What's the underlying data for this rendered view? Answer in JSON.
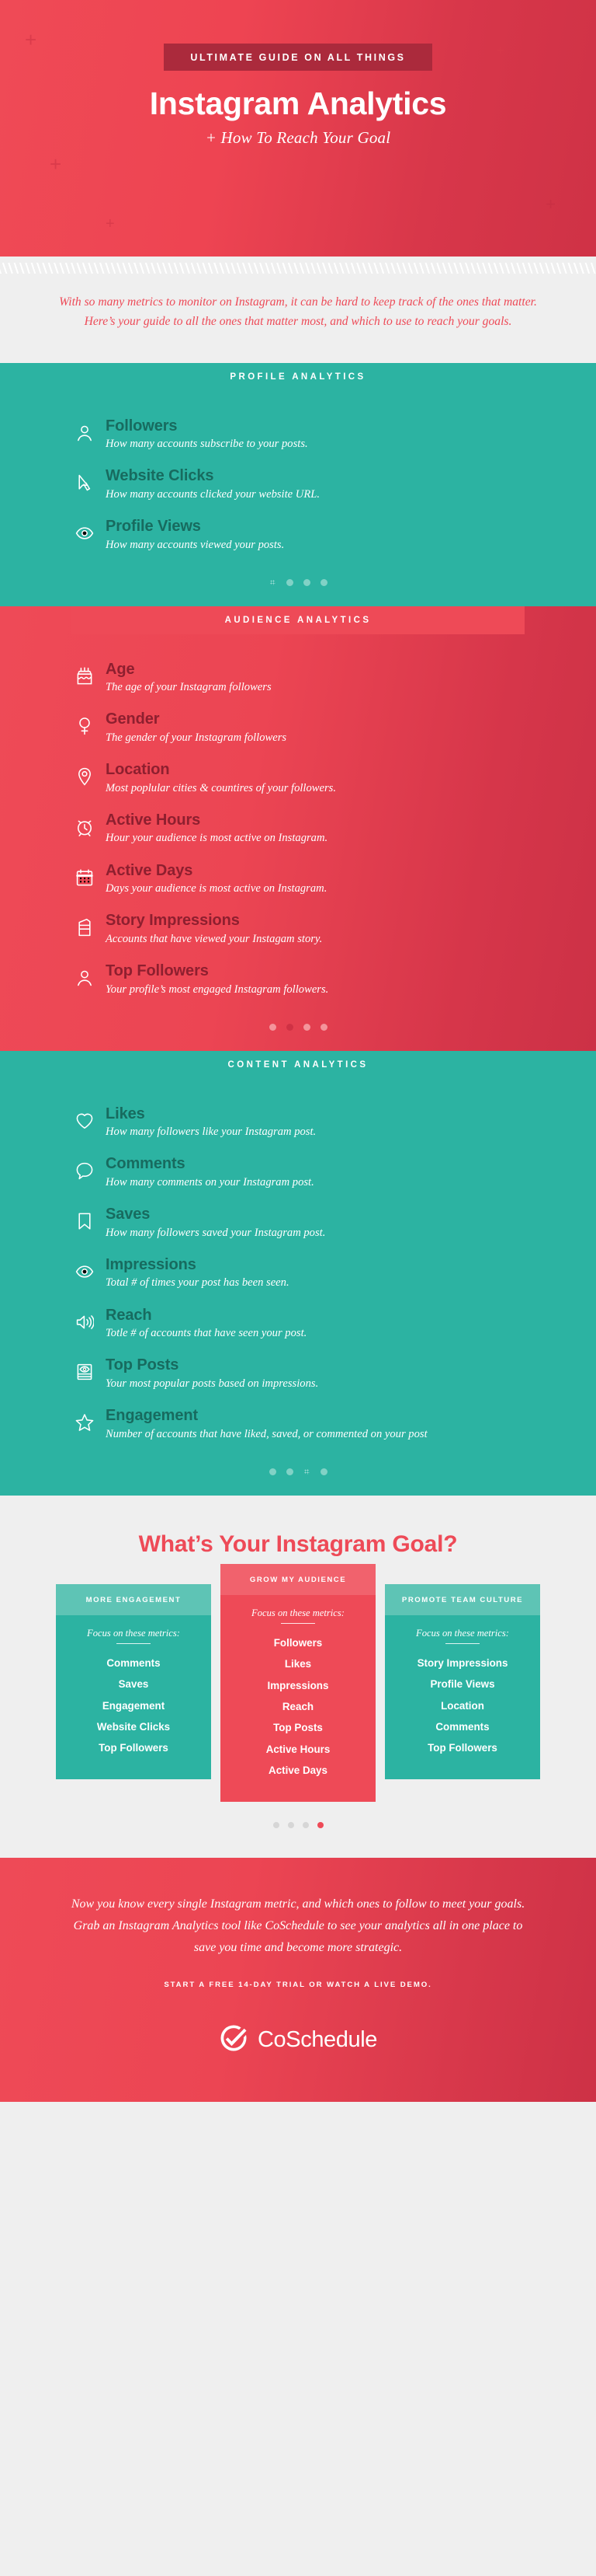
{
  "hero": {
    "eyebrow": "Ultimate Guide on All Things",
    "title": "Instagram Analytics",
    "subtitle": "+ How To Reach Your Goal"
  },
  "intro": {
    "paragraph": "With so many metrics to monitor on Instagram, it can be hard to keep track of the ones that matter. Here’s your guide to all the ones that matter most, and which to use to reach your goals."
  },
  "colors": {
    "red": "#ee4a57",
    "red_dark": "#ab2a3c",
    "teal": "#2cb3a2",
    "teal_dark": "#176b5f",
    "maroon_text": "#8e1f2f",
    "page_bg": "#efefef"
  },
  "sections": [
    {
      "id": "profile-analytics",
      "header": "Profile Analytics",
      "theme": "teal",
      "items": [
        {
          "icon": "person-icon",
          "title": "Followers",
          "desc": "How many accounts subscribe to your posts."
        },
        {
          "icon": "cursor-icon",
          "title": "Website Clicks",
          "desc": "How many accounts clicked your website URL."
        },
        {
          "icon": "eye-icon",
          "title": "Profile Views",
          "desc": "How many accounts viewed your posts."
        }
      ],
      "dots": {
        "count": 4,
        "states": [
          "ghost",
          "on",
          "on",
          "on"
        ]
      }
    },
    {
      "id": "audience-analytics",
      "header": "Audience Analytics",
      "theme": "red",
      "items": [
        {
          "icon": "cake-icon",
          "title": "Age",
          "desc": "The age of your Instagram followers"
        },
        {
          "icon": "gender-icon",
          "title": "Gender",
          "desc": "The gender of your Instagram followers"
        },
        {
          "icon": "map-pin-icon",
          "title": "Location",
          "desc": "Most poplular cities & countires of your followers."
        },
        {
          "icon": "alarm-clock-icon",
          "title": "Active Hours",
          "desc": "Hour your audience is most active on Instagram."
        },
        {
          "icon": "calendar-icon",
          "title": "Active Days",
          "desc": "Days your audience is most active on Instagram."
        },
        {
          "icon": "story-icon",
          "title": "Story Impressions",
          "desc": "Accounts that have viewed your Instagam story."
        },
        {
          "icon": "person-icon",
          "title": "Top Followers",
          "desc": "Your profile’s most engaged Instagram followers."
        }
      ],
      "dots": {
        "count": 4,
        "states": [
          "on",
          "active",
          "on",
          "on"
        ]
      }
    },
    {
      "id": "content-analytics",
      "header": "Content Analytics",
      "theme": "teal",
      "items": [
        {
          "icon": "heart-icon",
          "title": "Likes",
          "desc": "How many followers like your Instagram post."
        },
        {
          "icon": "comment-icon",
          "title": "Comments",
          "desc": "How many comments on your Instagram post."
        },
        {
          "icon": "bookmark-icon",
          "title": "Saves",
          "desc": "How many followers saved your Instagram post."
        },
        {
          "icon": "eye-icon",
          "title": "Impressions",
          "desc": "Total # of times your post has been seen."
        },
        {
          "icon": "speaker-icon",
          "title": "Reach",
          "desc": "Totle # of accounts that have seen your post."
        },
        {
          "icon": "top-post-icon",
          "title": "Top Posts",
          "desc": "Your most popular posts based on impressions."
        },
        {
          "icon": "star-icon",
          "title": "Engagement",
          "desc": "Number of accounts that have liked, saved, or commented on your post"
        }
      ],
      "dots": {
        "count": 4,
        "states": [
          "on",
          "on",
          "ghost",
          "on"
        ]
      }
    }
  ],
  "goal": {
    "title": "What’s Your Instagram Goal?",
    "focus_label": "Focus on these metrics:",
    "cards": [
      {
        "id": "more-engagement",
        "heading": "More Engagement",
        "theme": "teal",
        "raised": false,
        "metrics": [
          "Comments",
          "Saves",
          "Engagement",
          "Website Clicks",
          "Top Followers"
        ]
      },
      {
        "id": "grow-my-audience",
        "heading": "Grow My Audience",
        "theme": "red",
        "raised": true,
        "metrics": [
          "Followers",
          "Likes",
          "Impressions",
          "Reach",
          "Top Posts",
          "Active Hours",
          "Active Days"
        ]
      },
      {
        "id": "promote-team-culture",
        "heading": "Promote Team Culture",
        "theme": "teal",
        "raised": false,
        "metrics": [
          "Story Impressions",
          "Profile Views",
          "Location",
          "Comments",
          "Top Followers"
        ]
      }
    ],
    "dots": {
      "count": 4,
      "active_index": 3
    }
  },
  "footer": {
    "copy": "Now you know every single Instagram metric, and which ones to follow to meet your goals. Grab an Instagram Analytics tool like CoSchedule to see your analytics all in one place to save you time and become more strategic.",
    "cta": "Start a Free 14-Day Trial or Watch a Live Demo.",
    "brand_name": "CoSchedule"
  }
}
